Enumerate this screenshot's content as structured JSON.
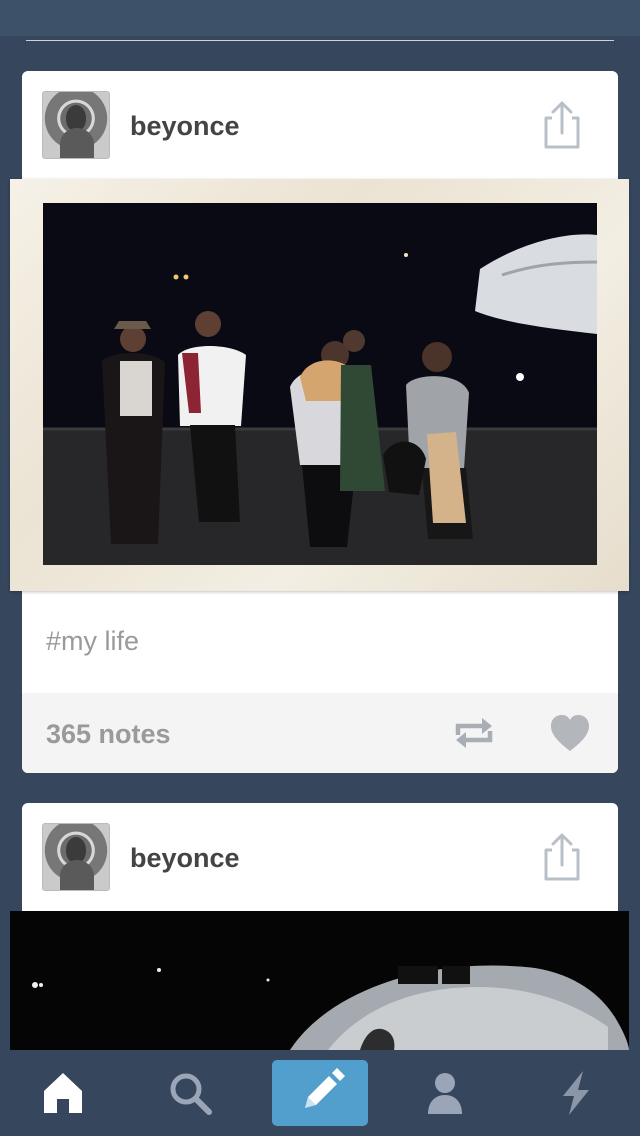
{
  "theme": {
    "background": "#36465d",
    "card": "#ffffff",
    "compose_accent": "#529ecc",
    "muted_text": "#9a9a9a"
  },
  "posts": [
    {
      "blog_name": "beyonce",
      "avatar_icon": "avatar-image",
      "share_icon": "share-icon",
      "caption": "#my life",
      "notes": "365 notes",
      "reblog_icon": "reblog-icon",
      "like_icon": "heart-icon"
    },
    {
      "blog_name": "beyonce",
      "avatar_icon": "avatar-image",
      "share_icon": "share-icon"
    }
  ],
  "tabbar": {
    "items": [
      {
        "name": "home",
        "icon": "home-icon"
      },
      {
        "name": "search",
        "icon": "search-icon"
      },
      {
        "name": "compose",
        "icon": "pencil-icon"
      },
      {
        "name": "account",
        "icon": "person-icon"
      },
      {
        "name": "activity",
        "icon": "lightning-icon"
      }
    ]
  }
}
